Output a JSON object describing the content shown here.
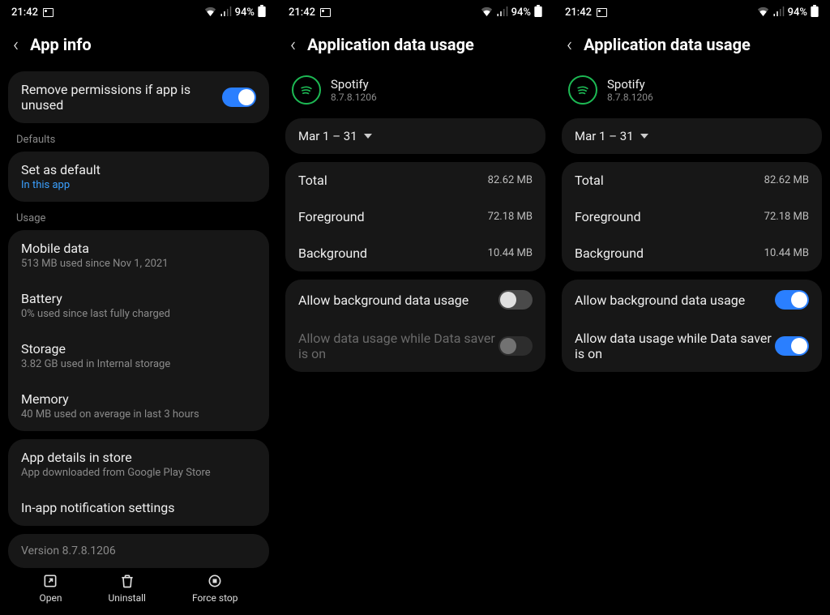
{
  "status": {
    "time": "21:42",
    "battery": "94%"
  },
  "phone1": {
    "title": "App info",
    "remove_perms": "Remove permissions if app is unused",
    "defaults_label": "Defaults",
    "set_default": "Set as default",
    "set_default_sub": "In this app",
    "usage_label": "Usage",
    "mobile_data": "Mobile data",
    "mobile_data_sub": "513 MB used since Nov 1, 2021",
    "battery": "Battery",
    "battery_sub": "0% used since last fully charged",
    "storage": "Storage",
    "storage_sub": "3.82 GB used in Internal storage",
    "memory": "Memory",
    "memory_sub": "40 MB used on average in last 3 hours",
    "details": "App details in store",
    "details_sub": "App downloaded from Google Play Store",
    "inapp": "In-app notification settings",
    "version": "Version 8.7.8.1206",
    "open": "Open",
    "uninstall": "Uninstall",
    "forcestop": "Force stop"
  },
  "datausage": {
    "title": "Application data usage",
    "app_name": "Spotify",
    "app_version": "8.7.8.1206",
    "range": "Mar 1 – 31",
    "total_label": "Total",
    "total_val": "82.62 MB",
    "fg_label": "Foreground",
    "fg_val": "72.18 MB",
    "bg_label": "Background",
    "bg_val": "10.44 MB",
    "allow_bg": "Allow background data usage",
    "allow_saver": "Allow data usage while Data saver is on"
  }
}
